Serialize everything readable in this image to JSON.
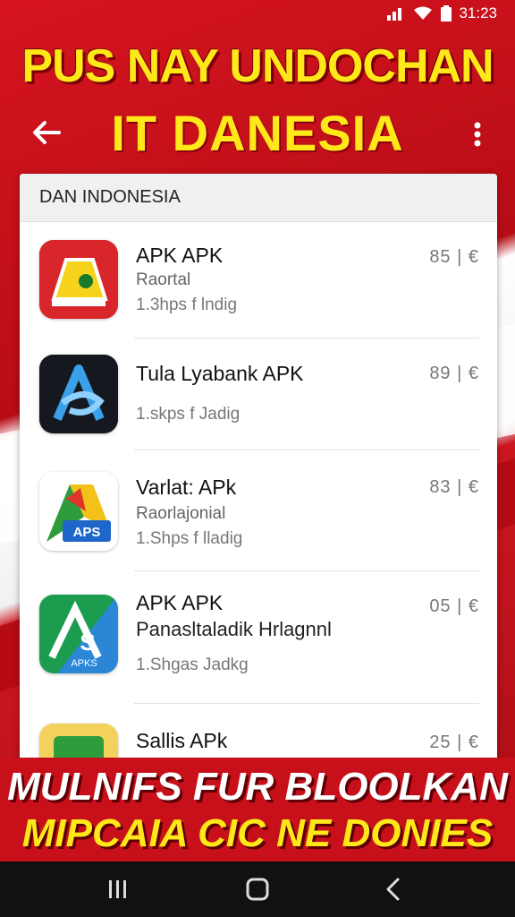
{
  "status_bar": {
    "time": "31:23"
  },
  "headline": {
    "line1": "PUS NAY UNDOCHAN",
    "title": "IT DANESIA"
  },
  "list": {
    "header": "DAN INDONESIA",
    "items": [
      {
        "name": "APK APK",
        "subtitle": "Raortal",
        "meta": "1.3hps f lndig",
        "price": "85 | €",
        "icon": "yellow-folder-app-icon"
      },
      {
        "name": "Tula Lyabank APK",
        "subtitle": "",
        "meta": "1.skps f Jadig",
        "price": "89 | €",
        "icon": "blue-a-app-icon"
      },
      {
        "name": "Varlat: APk",
        "subtitle": "Raorlajonial",
        "meta": "1.Shps f lladig",
        "price": "83 | €",
        "icon": "aps-triangle-app-icon"
      },
      {
        "name": "APK APK",
        "subtitle": "Panasltaladik Hrlagnnl",
        "meta": "1.Shgas Jadkg",
        "price": "05 | €",
        "icon": "apks-green-app-icon"
      },
      {
        "name": "Sallis APk",
        "subtitle": "",
        "meta": "",
        "price": "25 | €",
        "icon": "partial-app-icon"
      }
    ]
  },
  "bottom_banner": {
    "line1": "MULNIFS FUR BLOOLKAN",
    "line2": "MIPCAIA CIC NE DONIES"
  },
  "colors": {
    "brand_red": "#c8101a",
    "headline_yellow": "#ffe81a"
  }
}
